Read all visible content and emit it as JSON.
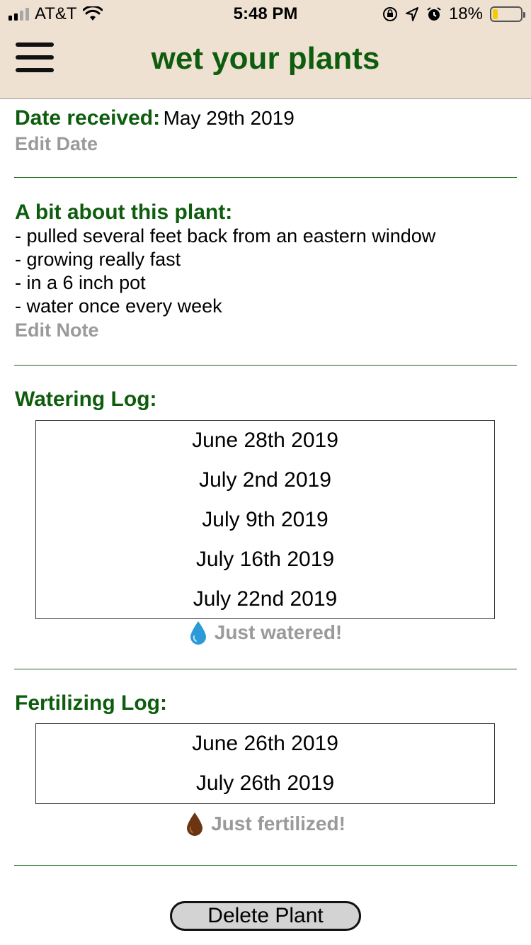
{
  "status_bar": {
    "carrier": "AT&T",
    "time": "5:48 PM",
    "battery": "18%",
    "battery_level": 0.18
  },
  "header": {
    "title": "wet your plants",
    "menu_icon": "hamburger-icon"
  },
  "date_received": {
    "label": "Date received:",
    "value": "May 29th 2019",
    "edit_label": "Edit Date"
  },
  "notes": {
    "label": "A bit about this plant:",
    "lines": [
      "- pulled several feet back from an eastern window",
      "- growing really fast",
      "- in a 6 inch pot",
      "- water once every week"
    ],
    "edit_label": "Edit Note"
  },
  "watering": {
    "label": "Watering Log:",
    "entries": [
      "June 28th 2019",
      "July 2nd 2019",
      "July 9th 2019",
      "July 16th 2019",
      "July 22nd 2019"
    ],
    "action_label": "Just watered!",
    "icon": "water-drop-icon",
    "icon_color": "#2b9ad8"
  },
  "fertilizing": {
    "label": "Fertilizing Log:",
    "entries": [
      "June 26th 2019",
      "July 26th 2019"
    ],
    "action_label": "Just fertilized!",
    "icon": "fertilizer-drop-icon",
    "icon_color": "#6b3512"
  },
  "delete_label": "Delete Plant",
  "colors": {
    "accent_green": "#0e5d0e",
    "header_bg": "#efe1d2",
    "muted": "#9a9a9a"
  }
}
